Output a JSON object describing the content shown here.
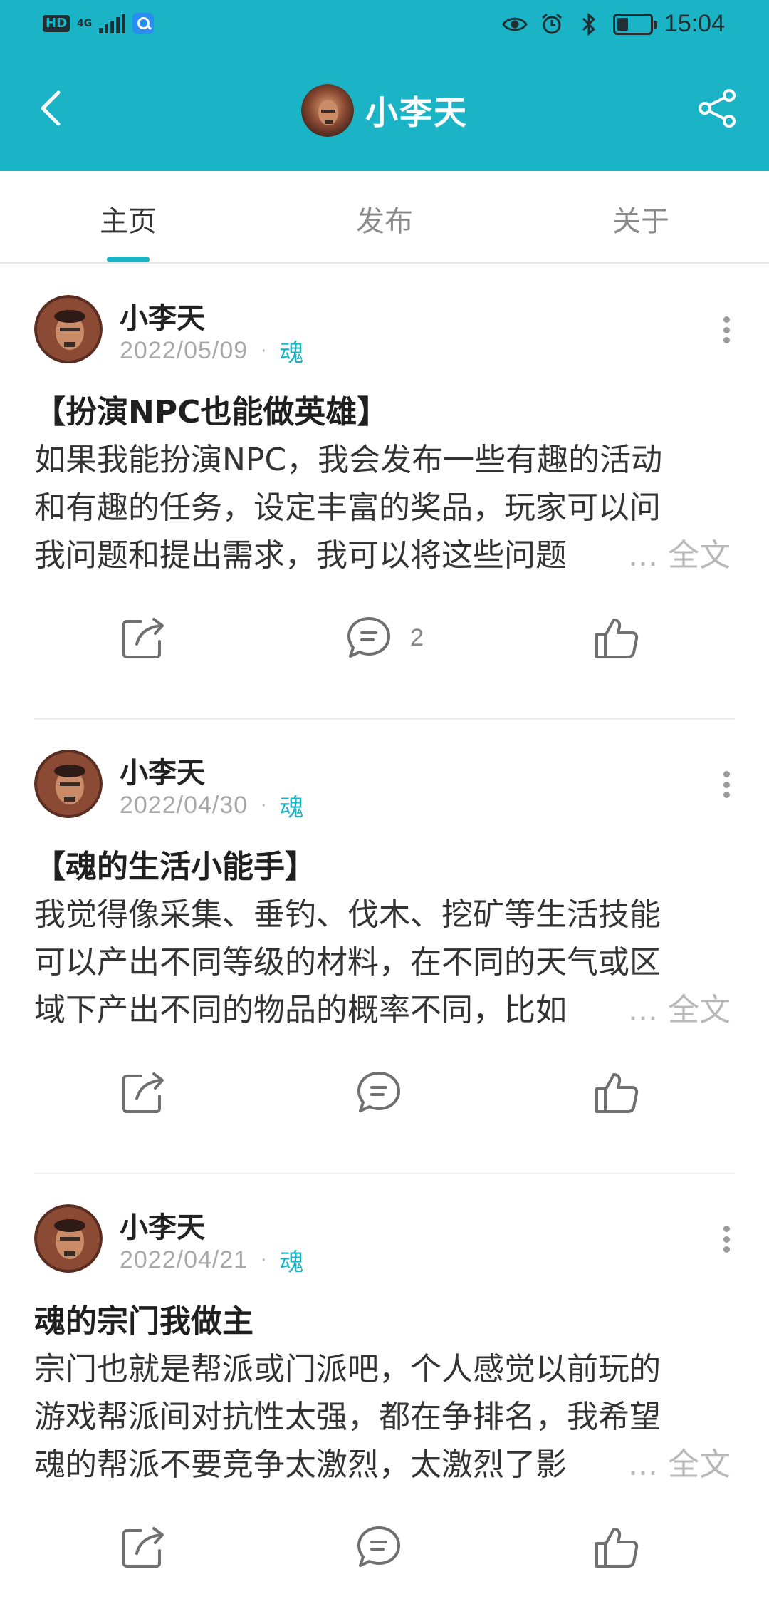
{
  "status_bar": {
    "hd_label": "HD",
    "network_label": "4G",
    "time": "15:04",
    "icons": [
      "signal-icon",
      "search-app-icon",
      "eye-icon",
      "alarm-icon",
      "bluetooth-icon",
      "battery-icon"
    ],
    "battery_level": 0.35
  },
  "header": {
    "title": "小李天",
    "back_icon": "chevron-left-icon",
    "share_icon": "share-icon",
    "background_color": "#1ab4c6"
  },
  "tabs": [
    {
      "label": "主页",
      "active": true
    },
    {
      "label": "发布",
      "active": false
    },
    {
      "label": "关于",
      "active": false
    }
  ],
  "accent_color": "#1ab4c6",
  "posts": [
    {
      "author": "小李天",
      "date": "2022/05/09",
      "tag": "魂",
      "title": "【扮演NPC也能做英雄】",
      "body_lines": [
        "如果我能扮演NPC，我会发布一些有趣的活动",
        "和有趣的任务，设定丰富的奖品，玩家可以问",
        "我问题和提出需求，我可以将这些问题"
      ],
      "more_label": "... 全文",
      "comment_count": "2"
    },
    {
      "author": "小李天",
      "date": "2022/04/30",
      "tag": "魂",
      "title": "【魂的生活小能手】",
      "body_lines": [
        "我觉得像采集、垂钓、伐木、挖矿等生活技能",
        "可以产出不同等级的材料，在不同的天气或区",
        "域下产出不同的物品的概率不同，比如"
      ],
      "more_label": "... 全文",
      "comment_count": ""
    },
    {
      "author": "小李天",
      "date": "2022/04/21",
      "tag": "魂",
      "title": "魂的宗门我做主",
      "body_lines": [
        "宗门也就是帮派或门派吧，个人感觉以前玩的",
        "游戏帮派间对抗性太强，都在争排名，我希望",
        "魂的帮派不要竞争太激烈，太激烈了影"
      ],
      "more_label": "... 全文",
      "comment_count": ""
    }
  ]
}
